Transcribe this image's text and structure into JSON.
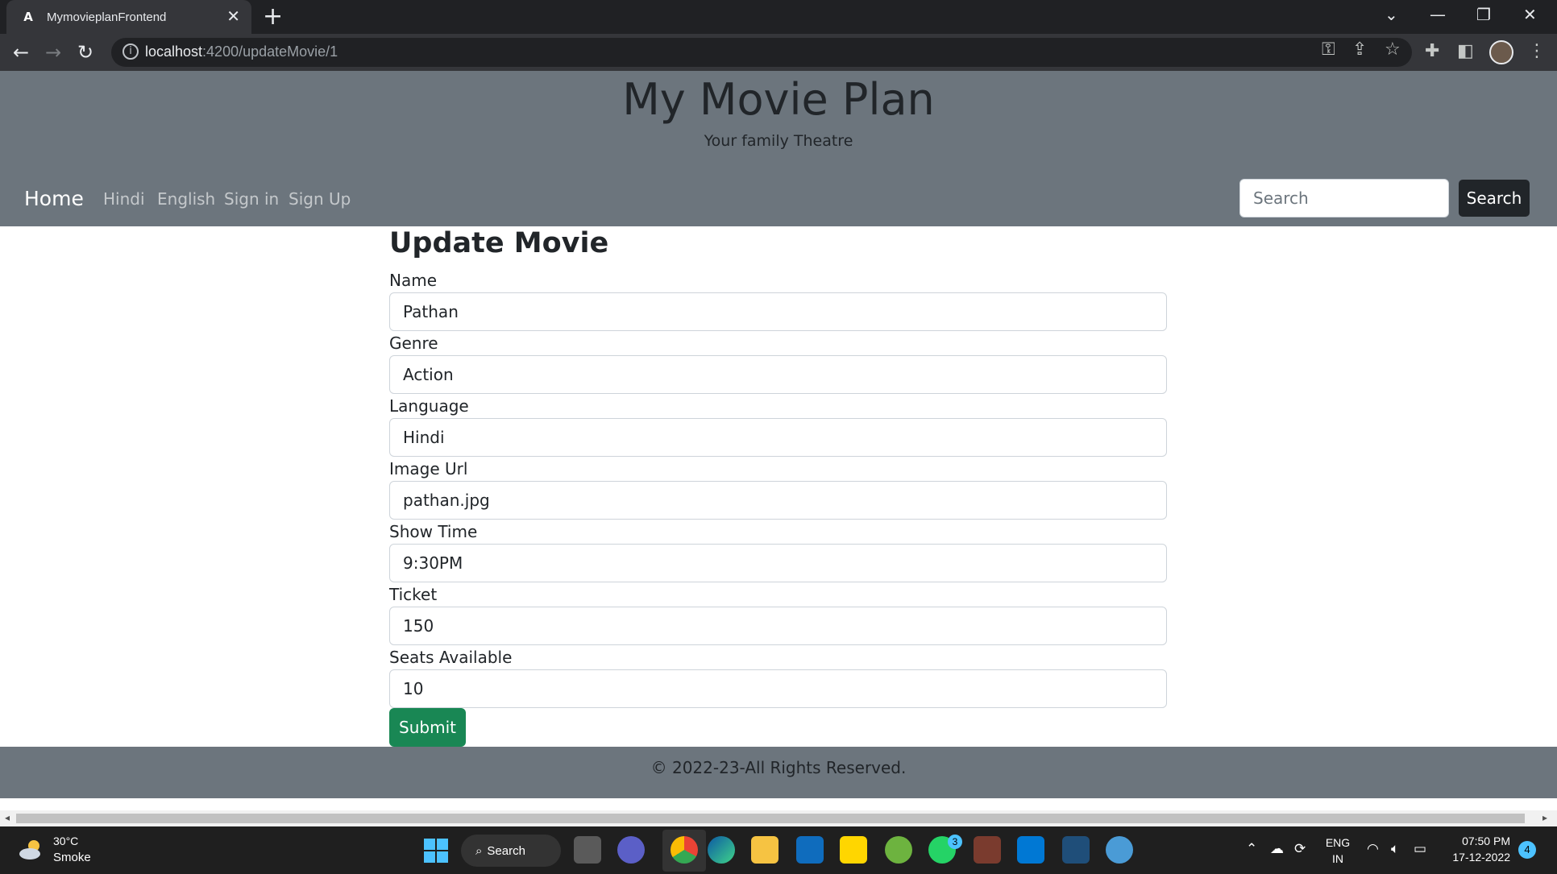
{
  "browser": {
    "tab_title": "MymovieplanFrontend",
    "url_host": "localhost",
    "url_rest": ":4200/updateMovie/1"
  },
  "site": {
    "title": "My Movie Plan",
    "tagline": "Your family Theatre",
    "nav": {
      "home": "Home",
      "links": [
        "Hindi",
        "English",
        "Sign in",
        "Sign Up"
      ]
    },
    "search": {
      "placeholder": "Search",
      "button": "Search"
    }
  },
  "form": {
    "title": "Update Movie",
    "fields": [
      {
        "label": "Name",
        "value": "Pathan"
      },
      {
        "label": "Genre",
        "value": "Action"
      },
      {
        "label": "Language",
        "value": "Hindi"
      },
      {
        "label": "Image Url",
        "value": "pathan.jpg"
      },
      {
        "label": "Show Time",
        "value": "9:30PM"
      },
      {
        "label": "Ticket",
        "value": "150"
      },
      {
        "label": "Seats Available",
        "value": "10"
      }
    ],
    "submit": "Submit"
  },
  "footer": {
    "text": "© 2022-23-All Rights Reserved."
  },
  "taskbar": {
    "weather_temp": "30°C",
    "weather_desc": "Smoke",
    "search_label": "Search",
    "whatsapp_badge": "3",
    "lang_top": "ENG",
    "lang_bottom": "IN",
    "time": "07:50 PM",
    "date": "17-12-2022",
    "notifications": "4"
  }
}
